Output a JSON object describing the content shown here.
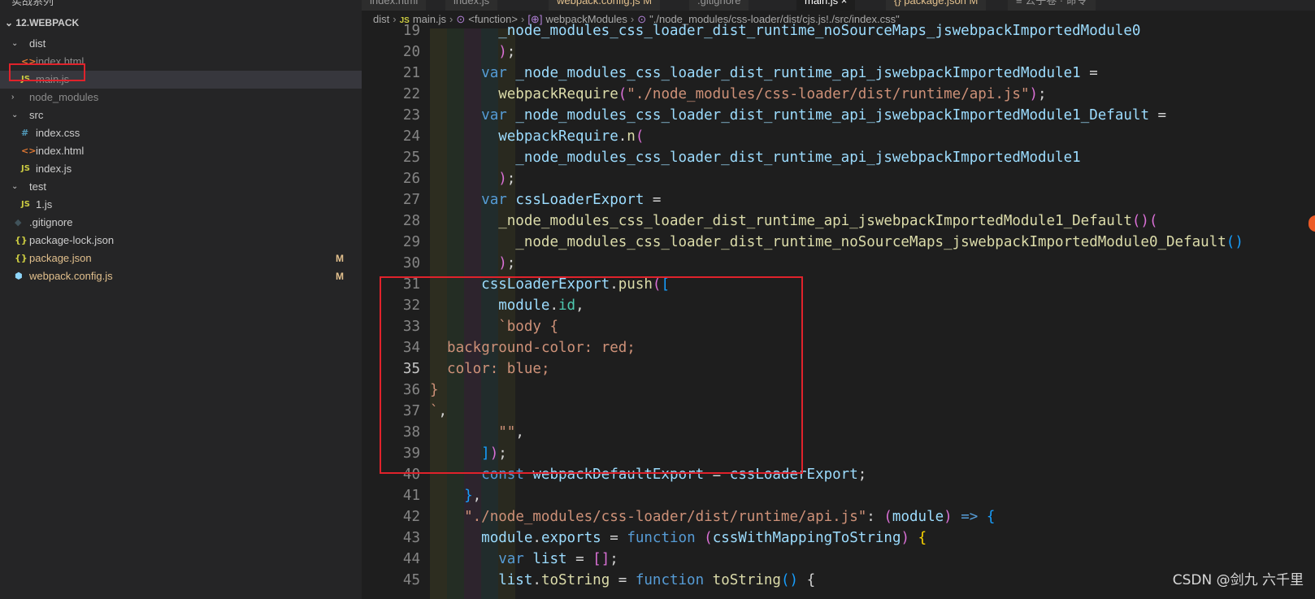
{
  "topbar": {
    "left_title": "实战系列",
    "tabs": [
      {
        "label": "index.html",
        "active": false,
        "yellow": false
      },
      {
        "label": "index.js",
        "active": false,
        "yellow": false
      },
      {
        "label": "webpack.config.js  M",
        "active": false,
        "yellow": true
      },
      {
        "label": ".gitignore",
        "active": false,
        "yellow": false
      },
      {
        "label": "main.js  ×",
        "active": true,
        "yellow": false
      },
      {
        "label": "{} package.json  M",
        "active": false,
        "yellow": true
      },
      {
        "label": "≡ 公子卷 · 命令",
        "active": false,
        "yellow": false
      }
    ]
  },
  "sidebar": {
    "root": "12.WEBPACK",
    "items": [
      {
        "type": "folder",
        "label": "dist",
        "open": true,
        "depth": 0
      },
      {
        "type": "html",
        "label": "index.html",
        "depth": 1,
        "dim": true
      },
      {
        "type": "js",
        "label": "main.js",
        "depth": 1,
        "selected": true,
        "dim": true
      },
      {
        "type": "folder",
        "label": "node_modules",
        "open": false,
        "depth": 0,
        "dim": true
      },
      {
        "type": "folder",
        "label": "src",
        "open": true,
        "depth": 0
      },
      {
        "type": "css",
        "label": "index.css",
        "depth": 1
      },
      {
        "type": "html",
        "label": "index.html",
        "depth": 1
      },
      {
        "type": "js",
        "label": "index.js",
        "depth": 1
      },
      {
        "type": "folder",
        "label": "test",
        "open": true,
        "depth": 0
      },
      {
        "type": "js",
        "label": "1.js",
        "depth": 1
      },
      {
        "type": "git",
        "label": ".gitignore",
        "depth": 0
      },
      {
        "type": "json",
        "label": "package-lock.json",
        "depth": 0
      },
      {
        "type": "json",
        "label": "package.json",
        "depth": 0,
        "badge": "M",
        "modified": true
      },
      {
        "type": "webpack",
        "label": "webpack.config.js",
        "depth": 0,
        "badge": "M",
        "modified": true
      }
    ],
    "icons": {
      "js": "JS",
      "html": "<>",
      "css": "#",
      "json": "{}",
      "git": "◆",
      "webpack": "⬢"
    }
  },
  "breadcrumb": {
    "items": [
      "dist",
      "JS",
      "main.js",
      "⊙",
      "<function>",
      "[⊕]",
      "webpackModules",
      "⊙",
      "\"./node_modules/css-loader/dist/cjs.js!./src/index.css\""
    ]
  },
  "editor": {
    "current_line": 35,
    "lines": [
      {
        "n": 19,
        "indent": 4,
        "tokens": [
          [
            "_node_modules_css_loader_dist_runtime_noSourceMaps_jswebpackImportedModule0",
            "v"
          ]
        ]
      },
      {
        "n": 20,
        "indent": 4,
        "tokens": [
          [
            ")",
            "b2"
          ],
          [
            ";",
            "p"
          ]
        ]
      },
      {
        "n": 21,
        "indent": 3,
        "tokens": [
          [
            "var ",
            "k"
          ],
          [
            "_node_modules_css_loader_dist_runtime_api_jswebpackImportedModule1",
            "v"
          ],
          [
            " =",
            "p"
          ]
        ]
      },
      {
        "n": 22,
        "indent": 4,
        "tokens": [
          [
            "webpackRequire",
            "f"
          ],
          [
            "(",
            "b2"
          ],
          [
            "\"./node_modules/css-loader/dist/runtime/api.js\"",
            "s"
          ],
          [
            ")",
            "b2"
          ],
          [
            ";",
            "p"
          ]
        ]
      },
      {
        "n": 23,
        "indent": 3,
        "tokens": [
          [
            "var ",
            "k"
          ],
          [
            "_node_modules_css_loader_dist_runtime_api_jswebpackImportedModule1_Default",
            "v"
          ],
          [
            " =",
            "p"
          ]
        ]
      },
      {
        "n": 24,
        "indent": 4,
        "tokens": [
          [
            "webpackRequire",
            "v"
          ],
          [
            ".",
            "p"
          ],
          [
            "n",
            "f"
          ],
          [
            "(",
            "b2"
          ]
        ]
      },
      {
        "n": 25,
        "indent": 5,
        "tokens": [
          [
            "_node_modules_css_loader_dist_runtime_api_jswebpackImportedModule1",
            "v"
          ]
        ]
      },
      {
        "n": 26,
        "indent": 4,
        "tokens": [
          [
            ")",
            "b2"
          ],
          [
            ";",
            "p"
          ]
        ]
      },
      {
        "n": 27,
        "indent": 3,
        "tokens": [
          [
            "var ",
            "k"
          ],
          [
            "cssLoaderExport",
            "v"
          ],
          [
            " =",
            "p"
          ]
        ]
      },
      {
        "n": 28,
        "indent": 4,
        "tokens": [
          [
            "_node_modules_css_loader_dist_runtime_api_jswebpackImportedModule1_Default",
            "f"
          ],
          [
            "()",
            "b2"
          ],
          [
            "(",
            "b2"
          ]
        ]
      },
      {
        "n": 29,
        "indent": 5,
        "tokens": [
          [
            "_node_modules_css_loader_dist_runtime_noSourceMaps_jswebpackImportedModule0_Default",
            "f"
          ],
          [
            "()",
            "b3"
          ]
        ]
      },
      {
        "n": 30,
        "indent": 4,
        "tokens": [
          [
            ")",
            "b2"
          ],
          [
            ";",
            "p"
          ]
        ]
      },
      {
        "n": 31,
        "indent": 3,
        "tokens": [
          [
            "cssLoaderExport",
            "v"
          ],
          [
            ".",
            "p"
          ],
          [
            "push",
            "f"
          ],
          [
            "(",
            "b2"
          ],
          [
            "[",
            "b3"
          ]
        ]
      },
      {
        "n": 32,
        "indent": 4,
        "tokens": [
          [
            "module",
            "v"
          ],
          [
            ".",
            "p"
          ],
          [
            "id",
            "prop"
          ],
          [
            ",",
            "p"
          ]
        ]
      },
      {
        "n": 33,
        "indent": 4,
        "tokens": [
          [
            "`body {",
            "s"
          ]
        ]
      },
      {
        "n": 34,
        "indent": 1,
        "tokens": [
          [
            "background-color: red;",
            "s"
          ]
        ]
      },
      {
        "n": 35,
        "indent": 1,
        "tokens": [
          [
            "color: blue;",
            "s"
          ]
        ]
      },
      {
        "n": 36,
        "indent": 0,
        "tokens": [
          [
            "}",
            "s"
          ]
        ]
      },
      {
        "n": 37,
        "indent": 0,
        "tokens": [
          [
            "`",
            "s"
          ],
          [
            ",",
            "p"
          ]
        ]
      },
      {
        "n": 38,
        "indent": 4,
        "tokens": [
          [
            "\"\"",
            "s"
          ],
          [
            ",",
            "p"
          ]
        ]
      },
      {
        "n": 39,
        "indent": 3,
        "tokens": [
          [
            "]",
            "b3"
          ],
          [
            ")",
            "b2"
          ],
          [
            ";",
            "p"
          ]
        ]
      },
      {
        "n": 40,
        "indent": 3,
        "tokens": [
          [
            "const ",
            "k"
          ],
          [
            "webpackDefaultExport",
            "v"
          ],
          [
            " = ",
            "p"
          ],
          [
            "cssLoaderExport",
            "v"
          ],
          [
            ";",
            "p"
          ]
        ]
      },
      {
        "n": 41,
        "indent": 2,
        "tokens": [
          [
            "}",
            "b3"
          ],
          [
            ",",
            "p"
          ]
        ]
      },
      {
        "n": 42,
        "indent": 2,
        "tokens": [
          [
            "\"./node_modules/css-loader/dist/runtime/api.js\"",
            "s"
          ],
          [
            ": ",
            "p"
          ],
          [
            "(",
            "b2"
          ],
          [
            "module",
            "v"
          ],
          [
            ")",
            "b2"
          ],
          [
            " => ",
            "k"
          ],
          [
            "{",
            "b3"
          ]
        ]
      },
      {
        "n": 43,
        "indent": 3,
        "tokens": [
          [
            "module",
            "v"
          ],
          [
            ".",
            "p"
          ],
          [
            "exports",
            "v"
          ],
          [
            " = ",
            "p"
          ],
          [
            "function ",
            "k"
          ],
          [
            "(",
            "b2"
          ],
          [
            "cssWithMappingToString",
            "v"
          ],
          [
            ")",
            "b2"
          ],
          [
            " ",
            "p"
          ],
          [
            "{",
            "b1"
          ]
        ]
      },
      {
        "n": 44,
        "indent": 4,
        "tokens": [
          [
            "var ",
            "k"
          ],
          [
            "list",
            "v"
          ],
          [
            " = ",
            "p"
          ],
          [
            "[]",
            "b2"
          ],
          [
            ";",
            "p"
          ]
        ]
      },
      {
        "n": 45,
        "indent": 4,
        "tokens": [
          [
            "list",
            "v"
          ],
          [
            ".",
            "p"
          ],
          [
            "toString",
            "f"
          ],
          [
            " = ",
            "p"
          ],
          [
            "function ",
            "k"
          ],
          [
            "toString",
            "f"
          ],
          [
            "()",
            "b3"
          ],
          [
            " {",
            "p"
          ]
        ]
      }
    ]
  },
  "watermark": "CSDN @剑九 六千里"
}
